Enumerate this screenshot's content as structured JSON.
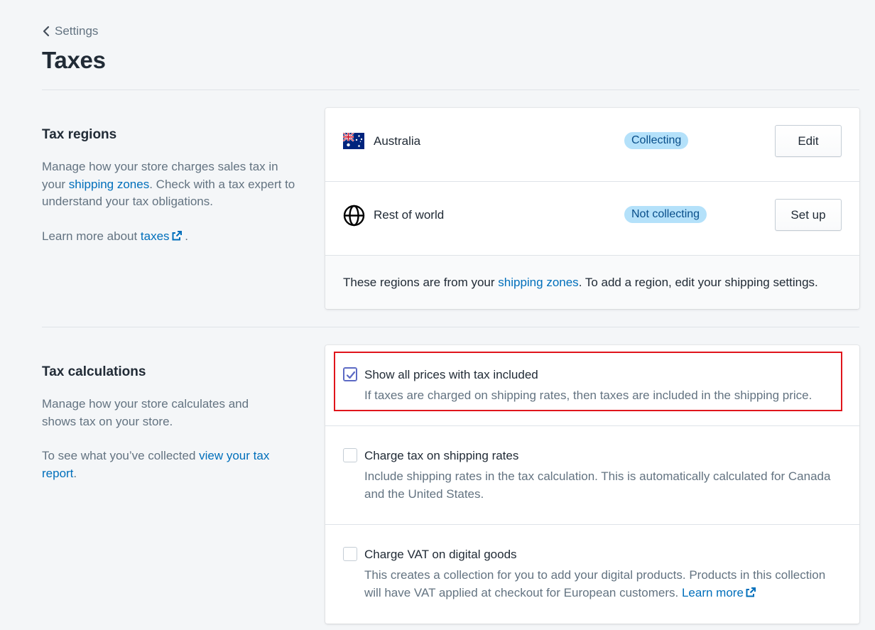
{
  "breadcrumb": {
    "label": "Settings"
  },
  "page": {
    "title": "Taxes"
  },
  "tax_regions": {
    "heading": "Tax regions",
    "desc_pre": "Manage how your store charges sales tax in your ",
    "desc_link": "shipping zones",
    "desc_post": ". Check with a tax expert to understand your tax obligations.",
    "learn_pre": "Learn more about ",
    "learn_link": "taxes",
    "learn_post": " .",
    "regions": [
      {
        "name": "Australia",
        "status": "Collecting",
        "action": "Edit",
        "icon": "australia-flag-icon"
      },
      {
        "name": "Rest of world",
        "status": "Not collecting",
        "action": "Set up",
        "icon": "globe-icon"
      }
    ],
    "footer_pre": "These regions are from your ",
    "footer_link": "shipping zones",
    "footer_post": ". To add a region, edit your shipping settings."
  },
  "tax_calculations": {
    "heading": "Tax calculations",
    "desc": "Manage how your store calculates and shows tax on your store.",
    "report_pre": "To see what you’ve collected ",
    "report_link": "view your tax report",
    "report_post": ".",
    "options": [
      {
        "label": "Show all prices with tax included",
        "help": "If taxes are charged on shipping rates, then taxes are included in the shipping price.",
        "checked": true
      },
      {
        "label": "Charge tax on shipping rates",
        "help": "Include shipping rates in the tax calculation. This is automatically calculated for Canada and the United States.",
        "checked": false
      },
      {
        "label": "Charge VAT on digital goods",
        "help": "This creates a collection for you to add your digital products. Products in this collection will have VAT applied at checkout for European customers. ",
        "help_link": "Learn more",
        "checked": false
      }
    ]
  },
  "colors": {
    "background": "#f4f6f8",
    "link": "#006fbb",
    "badge_bg": "#b4e1fa",
    "badge_text": "#084e8a",
    "checkbox_accent": "#5c6ac4",
    "highlight_border": "#e0151b"
  }
}
